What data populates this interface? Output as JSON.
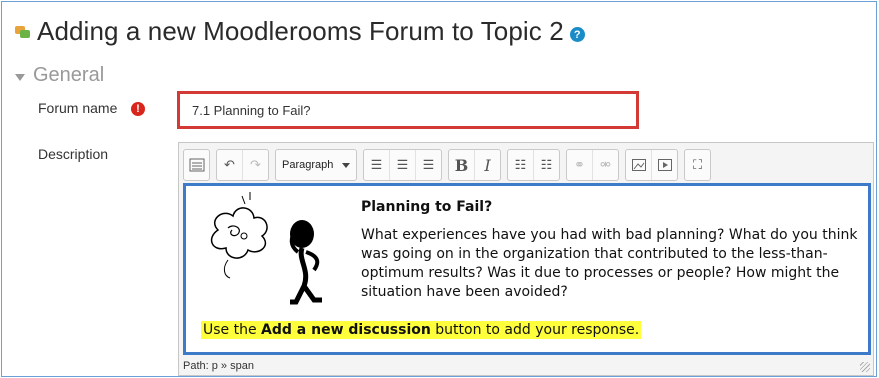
{
  "header": {
    "title": "Adding a new Moodlerooms Forum to Topic 2",
    "help_icon": "question-circle-icon",
    "forum_icon": "forum-icon"
  },
  "section": {
    "label": "General",
    "expanded": true
  },
  "form": {
    "forum_name": {
      "label": "Forum name",
      "value": "7.1 Planning to Fail?",
      "required_icon": "exclamation-circle-icon"
    },
    "description": {
      "label": "Description"
    }
  },
  "editor": {
    "toolbar": {
      "format_select": "Paragraph",
      "buttons": [
        "toggle-toolbar",
        "undo",
        "redo",
        "align-left",
        "align-center",
        "align-right",
        "bold",
        "italic",
        "bullet-list",
        "numbered-list",
        "link",
        "unlink",
        "image",
        "media",
        "fullscreen"
      ]
    },
    "content": {
      "heading": "Planning to Fail?",
      "body": "What experiences have you had with bad planning? What do you think was going on in the organization that contributed to the less-than-optimum results? Was it due to processes or people? How might the situation have been avoided?",
      "highlight_prefix": "Use the ",
      "highlight_bold": "Add a new discussion",
      "highlight_suffix": " button to add your response."
    },
    "path": "Path: p » span"
  },
  "colors": {
    "input_highlight": "#d33a35",
    "content_highlight": "#3d7ac7",
    "text_highlight": "#ffff3c",
    "required": "#d9261c",
    "help": "#1a8cc7"
  }
}
